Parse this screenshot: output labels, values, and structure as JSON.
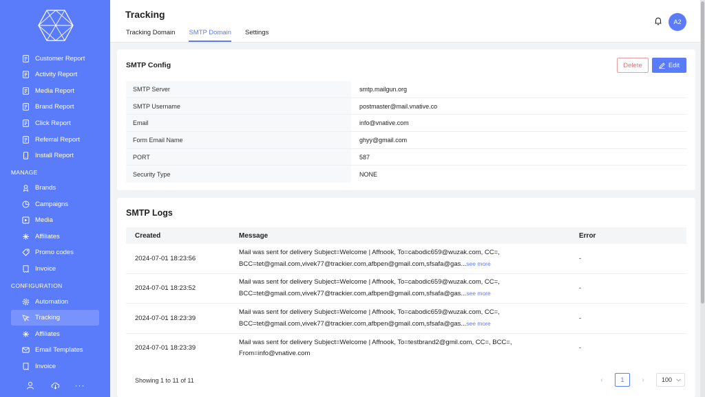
{
  "sidebar": {
    "reports": [
      {
        "label": "Customer Report",
        "icon": "report-icon"
      },
      {
        "label": "Activity Report",
        "icon": "report-icon"
      },
      {
        "label": "Media Report",
        "icon": "report-icon"
      },
      {
        "label": "Brand Report",
        "icon": "report-icon"
      },
      {
        "label": "Click Report",
        "icon": "report-icon"
      },
      {
        "label": "Referral Report",
        "icon": "report-icon"
      },
      {
        "label": "Install Report",
        "icon": "phone-icon"
      }
    ],
    "manage_heading": "MANAGE",
    "manage": [
      {
        "label": "Brands",
        "icon": "brand-icon"
      },
      {
        "label": "Campaigns",
        "icon": "pie-icon"
      },
      {
        "label": "Media",
        "icon": "media-icon"
      },
      {
        "label": "Affiliates",
        "icon": "affiliates-icon"
      },
      {
        "label": "Promo codes",
        "icon": "promo-icon"
      },
      {
        "label": "Invoice",
        "icon": "invoice-icon"
      }
    ],
    "config_heading": "CONFIGURATION",
    "config": [
      {
        "label": "Automation",
        "icon": "gear-icon"
      },
      {
        "label": "Tracking",
        "icon": "tracking-icon"
      },
      {
        "label": "Affiliates",
        "icon": "affiliates-icon"
      },
      {
        "label": "Email Templates",
        "icon": "mail-icon"
      },
      {
        "label": "Invoice",
        "icon": "invoice-icon"
      }
    ]
  },
  "header": {
    "title": "Tracking",
    "tabs": [
      "Tracking Domain",
      "SMTP Domain",
      "Settings"
    ],
    "active_tab": "SMTP Domain",
    "avatar": "A2"
  },
  "smtp_config": {
    "title": "SMTP Config",
    "delete_label": "Delete",
    "edit_label": "Edit",
    "rows": [
      {
        "label": "SMTP Server",
        "value": "smtp.mailgun.org"
      },
      {
        "label": "SMTP Username",
        "value": "postmaster@mail.vnative.co"
      },
      {
        "label": "Email",
        "value": "info@vnative.com"
      },
      {
        "label": "Form Email Name",
        "value": "ghyy@gmail.com"
      },
      {
        "label": "PORT",
        "value": "587"
      },
      {
        "label": "Security Type",
        "value": "NONE"
      }
    ]
  },
  "smtp_logs": {
    "title": "SMTP Logs",
    "columns": [
      "Created",
      "Message",
      "Error"
    ],
    "see_more": "see more",
    "rows": [
      {
        "created": "2024-07-01 18:23:56",
        "line1": "Mail was sent for delivery Subject=Welcome | Affnook, To=cabodic659@wuzak.com, CC=,",
        "line2": "BCC=tet@gmail.com,vivek77@trackier.com,afbpen@gmail.com,sfsafa@gas...",
        "error": "-"
      },
      {
        "created": "2024-07-01 18:23:52",
        "line1": "Mail was sent for delivery Subject=Welcome | Affnook, To=cabodic659@wuzak.com, CC=,",
        "line2": "BCC=tet@gmail.com,vivek77@trackier.com,afbpen@gmail.com,sfsafa@gas...",
        "error": "-"
      },
      {
        "created": "2024-07-01 18:23:39",
        "line1": "Mail was sent for delivery Subject=Welcome | Affnook, To=cabodic659@wuzak.com, CC=,",
        "line2": "BCC=tet@gmail.com,vivek77@trackier.com,afbpen@gmail.com,sfsafa@gas...",
        "error": "-"
      },
      {
        "created": "2024-07-01 18:23:39",
        "line1": "Mail was sent for delivery Subject=Welcome | Affnook, To=testbrand2@gmil.com, CC=, BCC=,",
        "line2": "From=info@vnative.com",
        "error": "-"
      }
    ],
    "showing": "Showing 1 to 11 of 11",
    "page": "1",
    "page_size": "100"
  },
  "colors": {
    "accent": "#5b7cfa",
    "danger": "#e57373"
  }
}
